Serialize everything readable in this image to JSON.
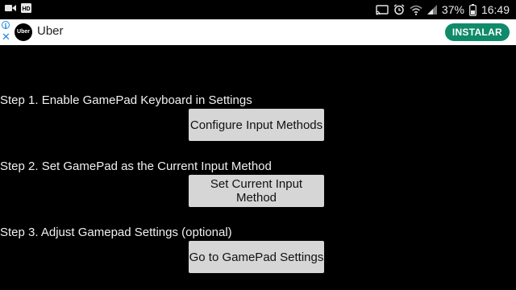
{
  "status_bar": {
    "battery_percent": "37%",
    "time": "16:49",
    "left_icons": [
      "video-camera-icon",
      "hd-icon"
    ],
    "right_icons": [
      "cast-icon",
      "alarm-icon",
      "wifi-icon",
      "signal-icon",
      "battery-icon"
    ]
  },
  "ad": {
    "info_glyph": "i",
    "close_glyph": "✕",
    "logo_text": "Uber",
    "title": "Uber",
    "cta_label": "INSTALAR",
    "cta_color": "#0f8a6a"
  },
  "steps": [
    {
      "label": "Step 1. Enable GamePad Keyboard in Settings",
      "button_label": "Configure Input Methods"
    },
    {
      "label": "Step 2. Set GamePad as the Current Input Method",
      "button_label": "Set Current Input Method"
    },
    {
      "label": "Step 3. Adjust Gamepad Settings (optional)",
      "button_label": "Go to GamePad Settings"
    }
  ],
  "colors": {
    "background": "#000000",
    "button_bg": "#d6d6d6",
    "text": "#f0f0f0"
  }
}
